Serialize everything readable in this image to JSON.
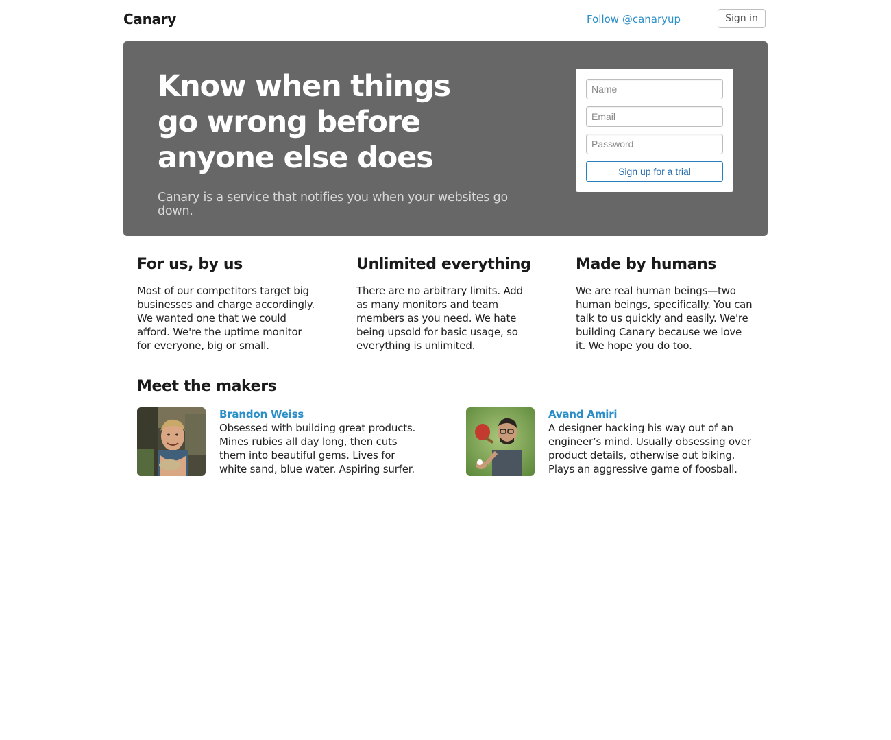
{
  "header": {
    "brand": "Canary",
    "follow_link": "Follow @canaryup",
    "signin_label": "Sign in"
  },
  "hero": {
    "title": "Know when things go wrong before anyone else does",
    "subtitle": "Canary is a service that notifies you when your websites go down.",
    "form": {
      "name_placeholder": "Name",
      "email_placeholder": "Email",
      "password_placeholder": "Password",
      "submit_label": "Sign up for a trial"
    }
  },
  "features": [
    {
      "title": "For us, by us",
      "body": "Most of our competitors target big businesses and charge accordingly. We wanted one that we could afford. We're the uptime monitor for everyone, big or small."
    },
    {
      "title": "Unlimited everything",
      "body": "There are no arbitrary limits. Add as many monitors and team members as you need. We hate being upsold for basic usage, so everything is unlimited."
    },
    {
      "title": "Made by humans",
      "body": "We are real human beings—two human beings, specifically. You can talk to us quickly and easily. We're building Canary because we love it. We hope you do too."
    }
  ],
  "makers": {
    "title": "Meet the makers",
    "people": [
      {
        "name": "Brandon Weiss",
        "bio": "Obsessed with building great products. Mines rubies all day long, then cuts them into beautiful gems. Lives for white sand, blue water. Aspiring surfer."
      },
      {
        "name": "Avand Amiri",
        "bio": "A designer hacking his way out of an engineer’s mind. Usually obsessing over product details, otherwise out biking. Plays an aggressive game of foosball."
      }
    ]
  },
  "colors": {
    "hero_background": "#676767",
    "link": "#2a8ec8",
    "button_border": "#2a7fbe"
  }
}
